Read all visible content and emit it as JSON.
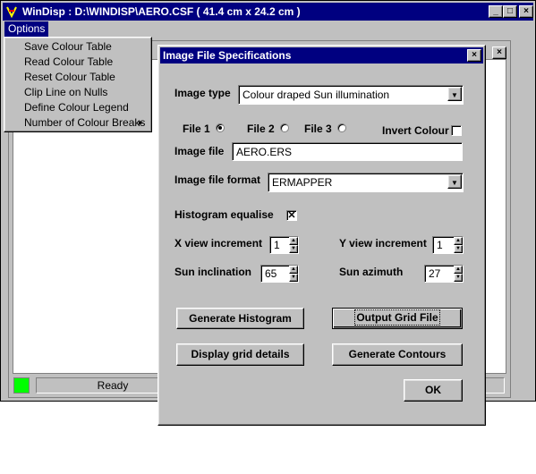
{
  "main_window": {
    "title": "WinDisp : D:\\WINDISP\\AERO.CSF ( 41.4 cm x 24.2 cm )",
    "menu_options": "Options"
  },
  "options_menu": {
    "items": [
      {
        "label": "Save Colour Table"
      },
      {
        "label": "Read Colour Table"
      },
      {
        "label": "Reset Colour Table"
      },
      {
        "label": "Clip Line on Nulls"
      },
      {
        "label": "Define Colour Legend"
      },
      {
        "label": "Number of Colour Breaks",
        "submenu_arrow": "▸"
      }
    ]
  },
  "status_bar": {
    "status_text": "Ready",
    "indicator_color": "#00ff00"
  },
  "dialog": {
    "title": "Image File Specifications",
    "image_type_label": "Image type",
    "image_type_value": "Colour draped Sun illumination",
    "file1_label": "File 1",
    "file2_label": "File 2",
    "file3_label": "File 3",
    "invert_colour_label": "Invert Colour",
    "image_file_label": "Image file",
    "image_file_value": "AERO.ERS",
    "image_file_format_label": "Image file format",
    "image_file_format_value": "ERMAPPER",
    "histogram_equalise_label": "Histogram equalise",
    "x_view_increment_label": "X view increment",
    "x_view_increment_value": "1",
    "y_view_increment_label": "Y view increment",
    "y_view_increment_value": "1",
    "sun_inclination_label": "Sun inclination",
    "sun_inclination_value": "65",
    "sun_azimuth_label": "Sun azimuth",
    "sun_azimuth_value": "27",
    "buttons": {
      "generate_histogram": "Generate Histogram",
      "output_grid_file": "Output Grid File",
      "display_grid_details": "Display grid details",
      "generate_contours": "Generate Contours",
      "ok": "OK"
    }
  }
}
